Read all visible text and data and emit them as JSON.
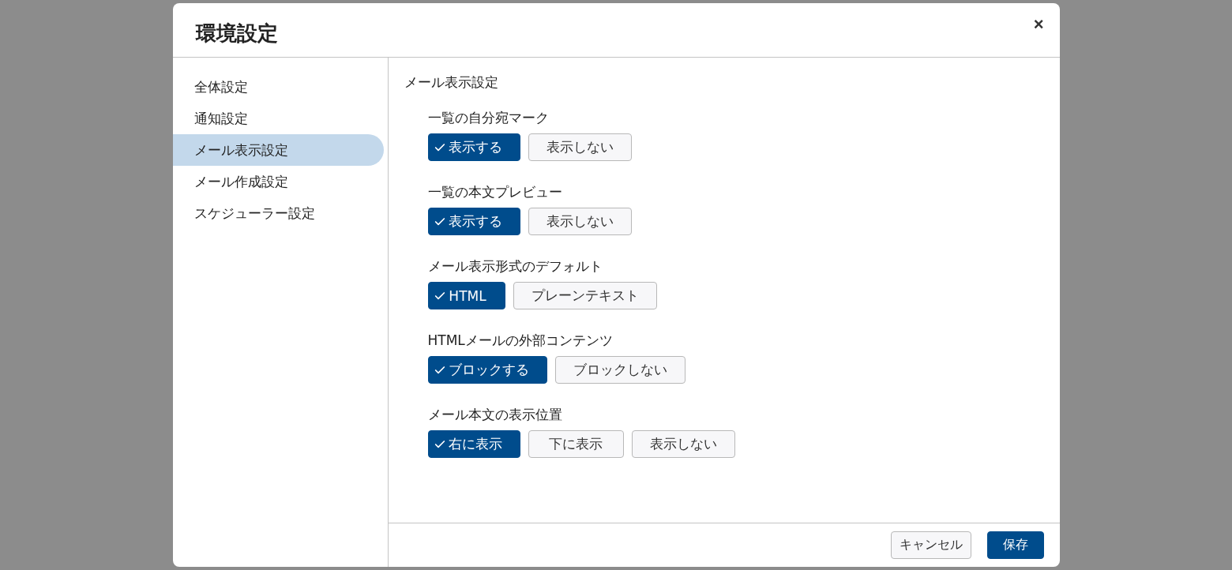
{
  "dialog": {
    "title": "環境設定",
    "close": "×"
  },
  "sidebar": {
    "items": [
      {
        "label": "全体設定",
        "selected": false
      },
      {
        "label": "通知設定",
        "selected": false
      },
      {
        "label": "メール表示設定",
        "selected": true
      },
      {
        "label": "メール作成設定",
        "selected": false
      },
      {
        "label": "スケジューラー設定",
        "selected": false
      }
    ]
  },
  "content": {
    "heading": "メール表示設定",
    "groups": [
      {
        "label": "一覧の自分宛マーク",
        "options": [
          {
            "label": "表示する",
            "selected": true
          },
          {
            "label": "表示しない",
            "selected": false
          }
        ]
      },
      {
        "label": "一覧の本文プレビュー",
        "options": [
          {
            "label": "表示する",
            "selected": true
          },
          {
            "label": "表示しない",
            "selected": false
          }
        ]
      },
      {
        "label": "メール表示形式のデフォルト",
        "options": [
          {
            "label": "HTML",
            "selected": true
          },
          {
            "label": "プレーンテキスト",
            "selected": false
          }
        ]
      },
      {
        "label": "HTMLメールの外部コンテンツ",
        "options": [
          {
            "label": "ブロックする",
            "selected": true
          },
          {
            "label": "ブロックしない",
            "selected": false
          }
        ]
      },
      {
        "label": "メール本文の表示位置",
        "options": [
          {
            "label": "右に表示",
            "selected": true
          },
          {
            "label": "下に表示",
            "selected": false
          },
          {
            "label": "表示しない",
            "selected": false
          }
        ]
      }
    ]
  },
  "footer": {
    "cancel": "キャンセル",
    "save": "保存"
  }
}
